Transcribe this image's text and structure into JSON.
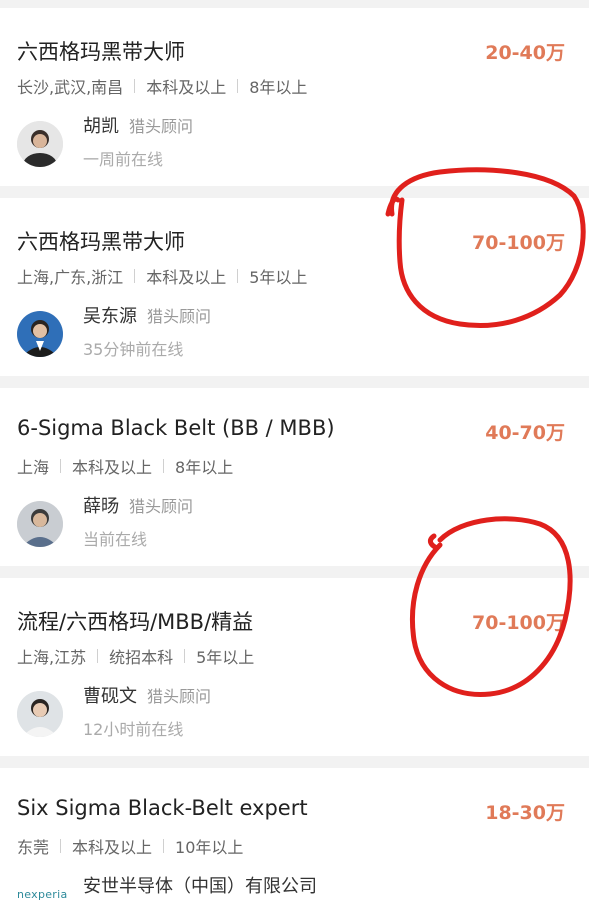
{
  "jobs": [
    {
      "title": "六西格玛黑带大师",
      "salary": "20-40万",
      "location": "长沙,武汉,南昌",
      "education": "本科及以上",
      "experience": "8年以上",
      "recruiter": "胡凯",
      "role": "猎头顾问",
      "online": "一周前在线"
    },
    {
      "title": "六西格玛黑带大师",
      "salary": "70-100万",
      "location": "上海,广东,浙江",
      "education": "本科及以上",
      "experience": "5年以上",
      "recruiter": "吴东源",
      "role": "猎头顾问",
      "online": "35分钟前在线"
    },
    {
      "title": "6-Sigma Black Belt (BB / MBB)",
      "salary": "40-70万",
      "location": "上海",
      "education": "本科及以上",
      "experience": "8年以上",
      "recruiter": "薛旸",
      "role": "猎头顾问",
      "online": "当前在线"
    },
    {
      "title": "流程/六西格玛/MBB/精益",
      "salary": "70-100万",
      "location": "上海,江苏",
      "education": "统招本科",
      "experience": "5年以上",
      "recruiter": "曹砚文",
      "role": "猎头顾问",
      "online": "12小时前在线"
    },
    {
      "title": "Six Sigma Black-Belt expert",
      "salary": "18-30万",
      "location": "东莞",
      "education": "本科及以上",
      "experience": "10年以上",
      "company_logo": "nexperia",
      "company": "安世半导体（中国）有限公司"
    }
  ],
  "colors": {
    "salary": "#e07a58",
    "annotation": "#e0201c",
    "background": "#f2f2f2"
  }
}
